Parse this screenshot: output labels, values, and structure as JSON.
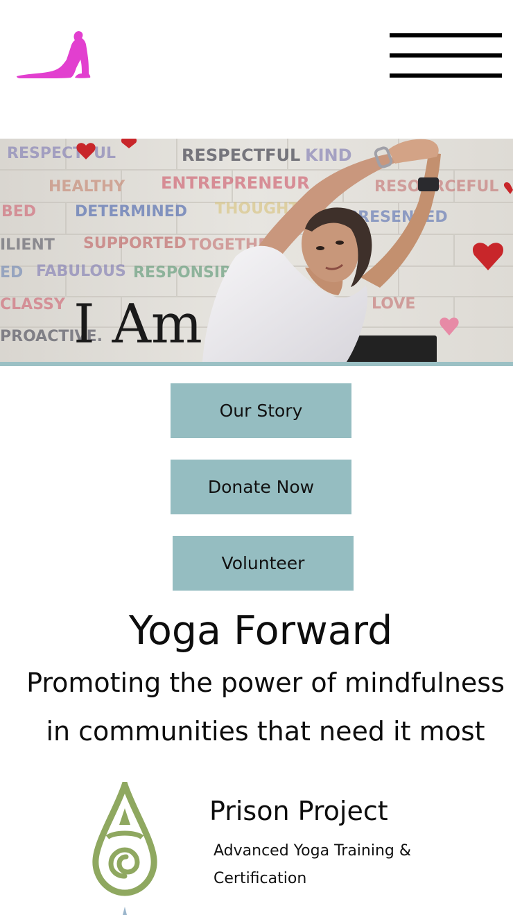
{
  "header": {
    "logo_icon": "yoga-cobra-pose-icon",
    "logo_color": "#e23fcf",
    "menu_icon": "hamburger-menu-icon"
  },
  "hero": {
    "wall_words": [
      "RESPECTFUL",
      "KIND",
      "HEALTHY",
      "ENTREPRENEUR",
      "DETERMINED",
      "THOUGHTFUL",
      "SUPPORTED",
      "FABULOUS",
      "RESPONSIBLE",
      "CLASSY",
      "PROACTIVE",
      "RESILIENT",
      "I Am..."
    ]
  },
  "actions": {
    "story": "Our Story",
    "donate": "Donate Now",
    "volunteer": "Volunteer",
    "button_color": "#95bdc1"
  },
  "intro": {
    "title": "Yoga Forward",
    "tagline_line1": "Promoting the power of mindfulness",
    "tagline_line2": "in communities that need it most"
  },
  "project": {
    "icon": "spiral-drop-icon",
    "icon_color": "#8fa860",
    "title": "Prison Project",
    "description_line1": "Advanced Yoga Training &",
    "description_line2": "Certification"
  }
}
